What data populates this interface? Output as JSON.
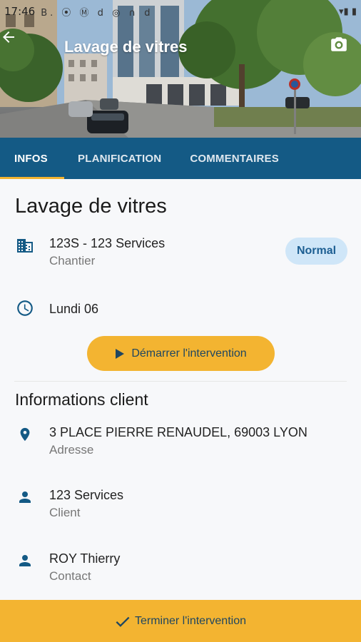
{
  "status_bar": {
    "time": "17:46",
    "icons_left": "B. ⦿ Ⓜ d ◎ ∩ d",
    "icons_right": "▾▮ ▮"
  },
  "appbar": {
    "title": "Lavage de vitres",
    "back_icon": "arrow-back-icon",
    "camera_icon": "camera-icon"
  },
  "tabs": [
    {
      "label": "INFOS",
      "active": true
    },
    {
      "label": "PLANIFICATION",
      "active": false
    },
    {
      "label": "COMMENTAIRES",
      "active": false
    }
  ],
  "job": {
    "title": "Lavage de vitres",
    "site": {
      "primary": "123S - 123 Services",
      "secondary": "Chantier",
      "icon": "building-icon"
    },
    "priority": "Normal",
    "date": {
      "primary": "Lundi 06",
      "icon": "clock-icon"
    },
    "start_button": "Démarrer l'intervention"
  },
  "client_section": {
    "title": "Informations client",
    "rows": [
      {
        "primary": "3 PLACE PIERRE RENAUDEL, 69003 LYON",
        "secondary": "Adresse",
        "icon": "location-pin-icon"
      },
      {
        "primary": "123 Services",
        "secondary": "Client",
        "icon": "person-icon"
      },
      {
        "primary": "ROY Thierry",
        "secondary": "Contact",
        "icon": "person-icon"
      }
    ]
  },
  "finish_button": "Terminer l'intervention",
  "colors": {
    "primary": "#145a85",
    "accent": "#f3b431",
    "badge_bg": "#cfe6f8"
  }
}
